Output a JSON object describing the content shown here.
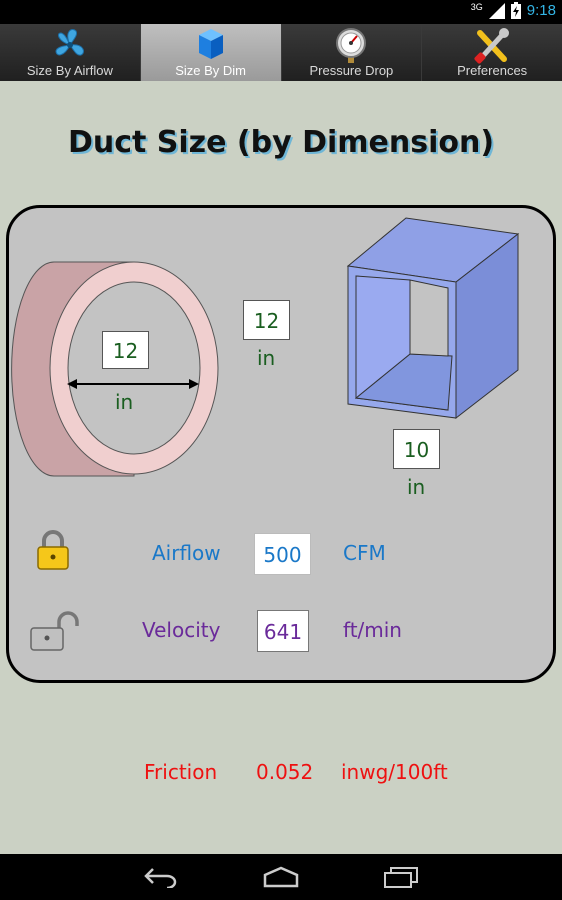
{
  "status": {
    "time": "9:18",
    "network": "3G"
  },
  "tabs": [
    {
      "label": "Size By Airflow",
      "icon": "fan-icon"
    },
    {
      "label": "Size By Dim",
      "icon": "cube-icon"
    },
    {
      "label": "Pressure Drop",
      "icon": "gauge-icon"
    },
    {
      "label": "Preferences",
      "icon": "tools-icon"
    }
  ],
  "page": {
    "title": "Duct Size (by Dimension)"
  },
  "round_duct": {
    "diameter": "12",
    "unit": "in"
  },
  "rect_duct": {
    "height": "12",
    "height_unit": "in",
    "width": "10",
    "width_unit": "in"
  },
  "airflow": {
    "label": "Airflow",
    "value": "500",
    "unit": "CFM",
    "locked": true,
    "color": "#1a78c8"
  },
  "velocity": {
    "label": "Velocity",
    "value": "641",
    "unit": "ft/min",
    "locked": false,
    "color": "#6a2a9a"
  },
  "friction": {
    "label": "Friction",
    "value": "0.052",
    "unit": "inwg/100ft",
    "color": "#ee1111"
  }
}
